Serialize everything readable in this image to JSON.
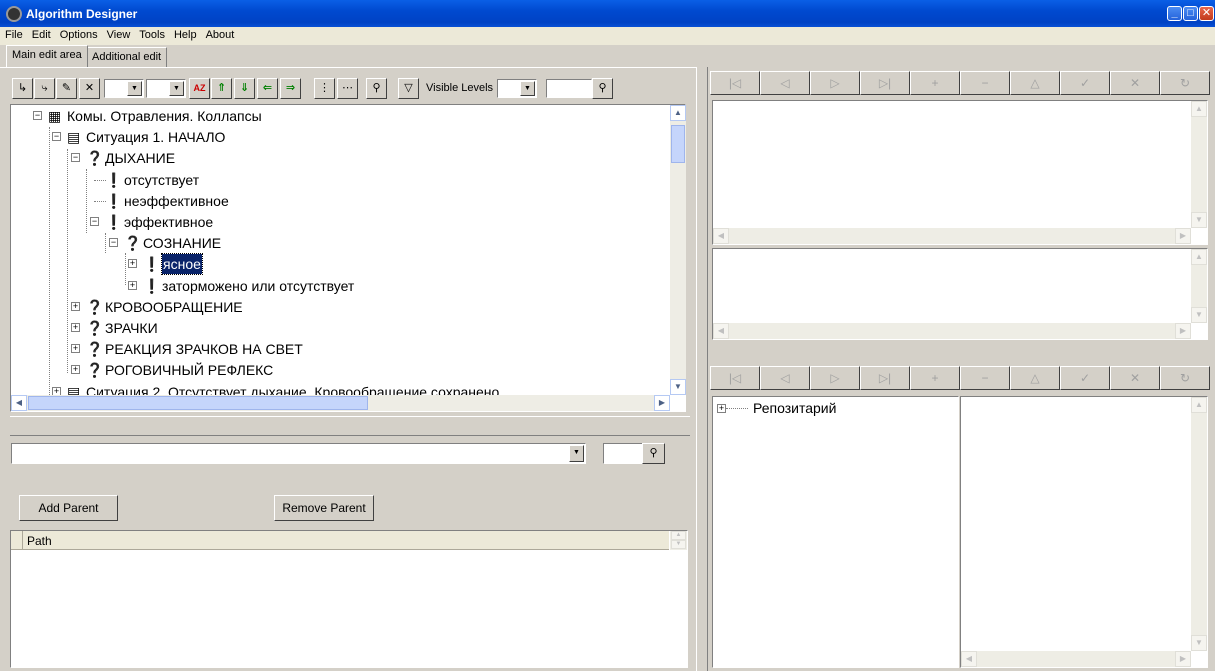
{
  "window": {
    "title": "Algorithm Designer"
  },
  "menu": [
    "File",
    "Edit",
    "Options",
    "View",
    "Tools",
    "Help",
    "About"
  ],
  "tabs": [
    {
      "label": "Main edit area",
      "active": true
    },
    {
      "label": "Additional edit",
      "active": false
    }
  ],
  "toolbar": {
    "visible_levels_label": "Visible Levels",
    "combo1_value": "",
    "combo2_value": "",
    "levels_value": "",
    "search_value": ""
  },
  "tree": [
    {
      "label": "Комы. Отравления. Коллапсы",
      "level": 0,
      "icon": "table-icon",
      "expand": "minus",
      "selected": false
    },
    {
      "label": "Ситуация 1. НАЧАЛО",
      "level": 1,
      "icon": "list-icon",
      "expand": "minus",
      "selected": false
    },
    {
      "label": "ДЫХАНИЕ",
      "level": 2,
      "icon": "question-icon",
      "expand": "minus",
      "selected": false
    },
    {
      "label": "отсутствует",
      "level": 3,
      "icon": "exclamation-icon",
      "expand": "",
      "selected": false
    },
    {
      "label": "неэффективное",
      "level": 3,
      "icon": "exclamation-icon",
      "expand": "",
      "selected": false
    },
    {
      "label": "эффективное",
      "level": 3,
      "icon": "exclamation-icon",
      "expand": "minus",
      "selected": false
    },
    {
      "label": "СОЗНАНИЕ",
      "level": 4,
      "icon": "question-icon",
      "expand": "minus",
      "selected": false
    },
    {
      "label": "ясное",
      "level": 5,
      "icon": "exclamation-icon",
      "expand": "plus",
      "selected": true
    },
    {
      "label": "заторможено или отсутствует",
      "level": 5,
      "icon": "exclamation-icon",
      "expand": "plus",
      "selected": false
    },
    {
      "label": "КРОВООБРАЩЕНИЕ",
      "level": 2,
      "icon": "question-icon",
      "expand": "plus",
      "selected": false
    },
    {
      "label": "ЗРАЧКИ",
      "level": 2,
      "icon": "question-icon",
      "expand": "plus",
      "selected": false
    },
    {
      "label": "РЕАКЦИЯ ЗРАЧКОВ НА СВЕТ",
      "level": 2,
      "icon": "question-icon",
      "expand": "plus",
      "selected": false
    },
    {
      "label": "РОГОВИЧНЫЙ РЕФЛЕКС",
      "level": 2,
      "icon": "question-icon",
      "expand": "plus",
      "selected": false
    },
    {
      "label": "Ситуация 2. Отсутствует дыхание. Кровообращение сохранено",
      "level": 1,
      "icon": "list-icon",
      "expand": "plus",
      "selected": false
    }
  ],
  "parent_panel": {
    "combo_value": "",
    "search_value": "",
    "add_parent_label": "Add Parent",
    "remove_parent_label": "Remove Parent"
  },
  "path_list": {
    "column_header": "Path"
  },
  "repository": {
    "root_label": "Репозитарий"
  },
  "colors": {
    "title_bar": "#0049cf",
    "selection": "#0a246a",
    "face": "#d4d0c8"
  }
}
